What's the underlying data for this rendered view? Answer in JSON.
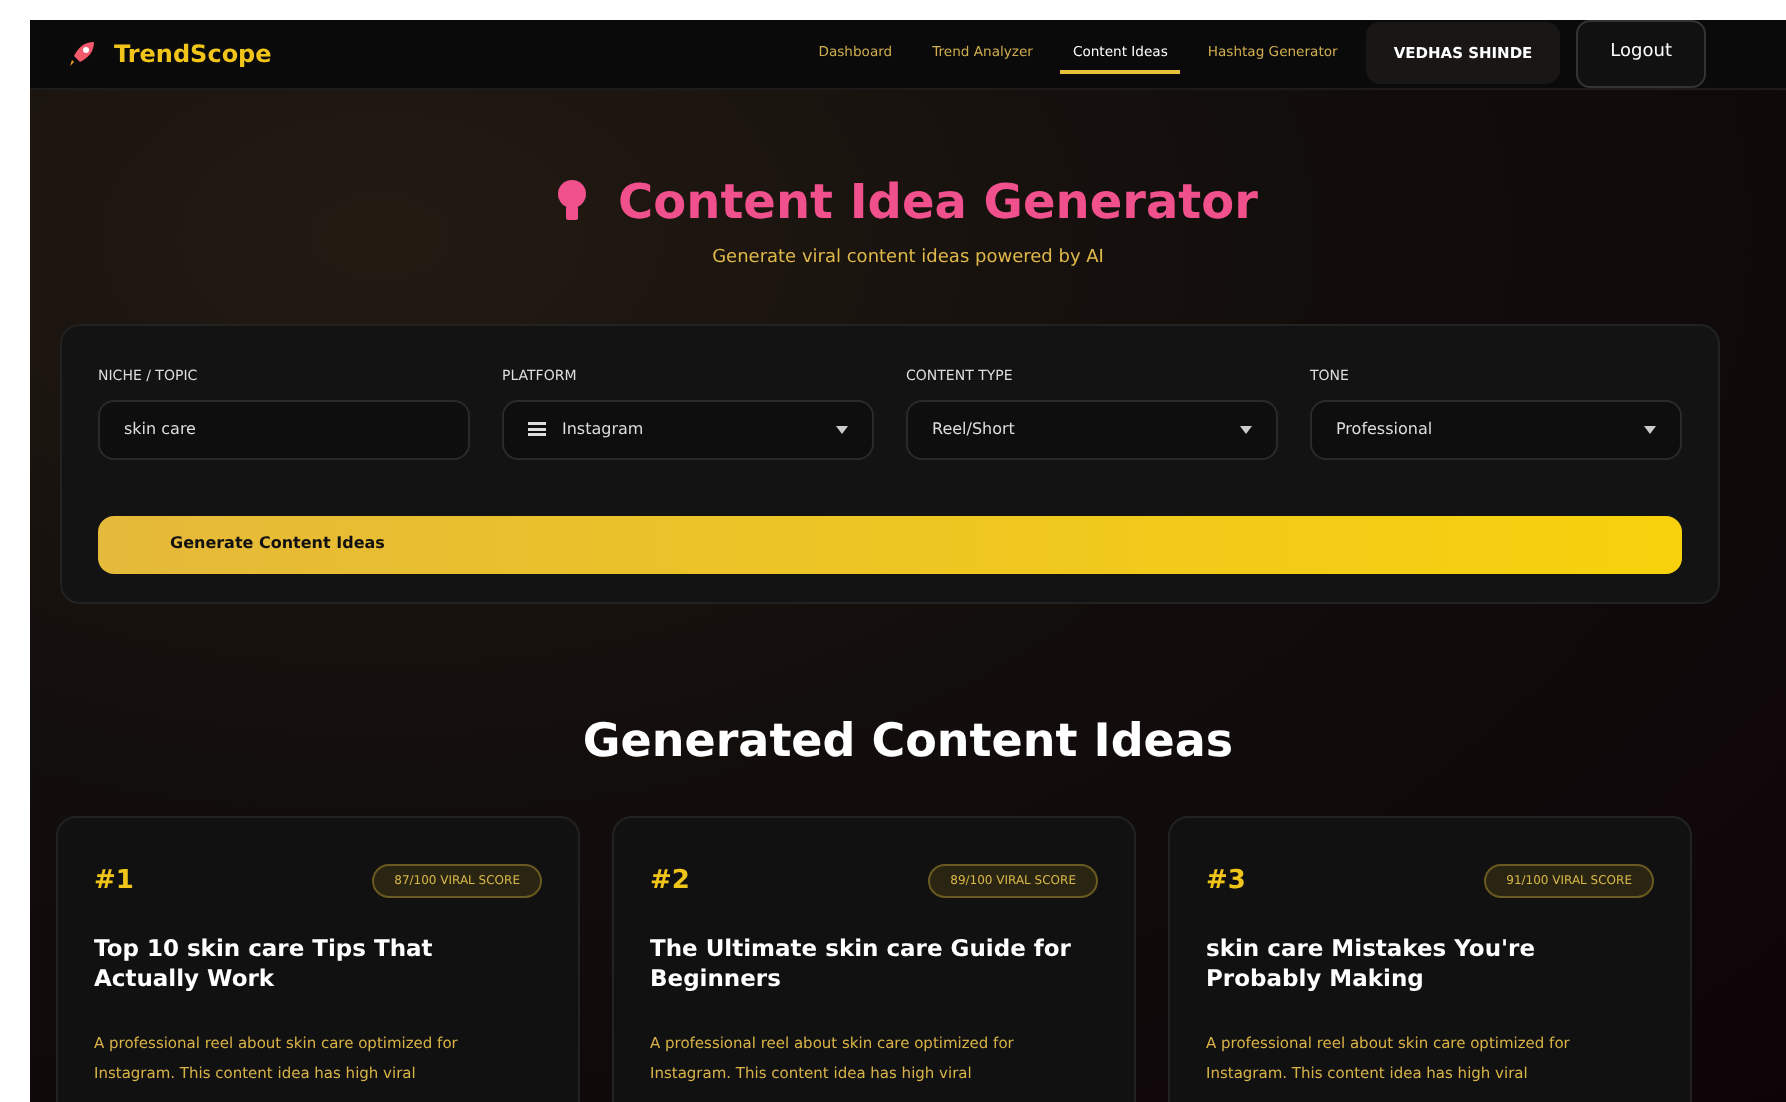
{
  "brand": {
    "name": "TrendScope"
  },
  "nav": [
    {
      "label": "Dashboard",
      "selected": false
    },
    {
      "label": "Trend Analyzer",
      "selected": false
    },
    {
      "label": "Content Ideas",
      "selected": true
    },
    {
      "label": "Hashtag Generator",
      "selected": false
    }
  ],
  "user": {
    "name": "VEDHAS SHINDE"
  },
  "logout": "Logout",
  "hero": {
    "title": "Content Idea Generator",
    "subtitle": "Generate viral content ideas powered by AI"
  },
  "form": {
    "fields": [
      {
        "label": "NICHE / TOPIC",
        "kind": "input",
        "value": "skin care"
      },
      {
        "label": "PLATFORM",
        "kind": "select",
        "value": "Instagram",
        "icon": true
      },
      {
        "label": "CONTENT TYPE",
        "kind": "select",
        "value": "Reel/Short"
      },
      {
        "label": "TONE",
        "kind": "select",
        "value": "Professional"
      }
    ],
    "button": "Generate Content Ideas"
  },
  "results": {
    "heading": "Generated Content Ideas",
    "ideas": [
      {
        "rank": "#1",
        "score": "87/100 VIRAL SCORE",
        "title": "Top 10 skin care Tips That Actually Work",
        "description": "A professional reel about skin care optimized for Instagram. This content idea has high viral"
      },
      {
        "rank": "#2",
        "score": "89/100 VIRAL SCORE",
        "title": "The Ultimate skin care Guide for Beginners",
        "description": "A professional reel about skin care optimized for Instagram. This content idea has high viral"
      },
      {
        "rank": "#3",
        "score": "91/100 VIRAL SCORE",
        "title": "skin care Mistakes You're Probably Making",
        "description": "A professional reel about skin care optimized for Instagram. This content idea has high viral"
      }
    ]
  }
}
